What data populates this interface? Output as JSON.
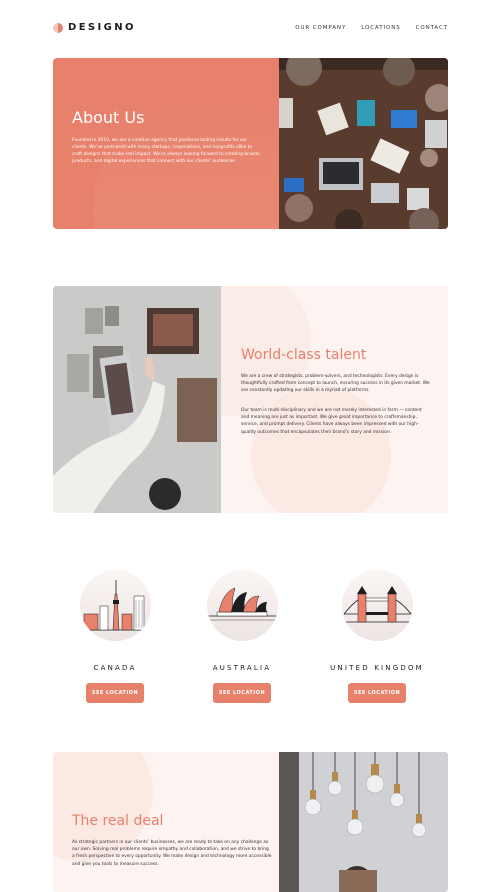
{
  "brand": {
    "name": "DESIGNO"
  },
  "nav": {
    "items": [
      "OUR COMPANY",
      "LOCATIONS",
      "CONTACT"
    ]
  },
  "about": {
    "title": "About Us",
    "body": "Founded in 2010, we are a creative agency that produces lasting results for our clients. We’ve partnered with many startups, corporations, and nonprofits alike to craft designs that make real impact. We’re always looking forward to creating brands, products, and digital experiences that connect with our clients’ audiences."
  },
  "talent": {
    "title": "World-class talent",
    "body1": "We are a crew of strategists, problem-solvers, and technologists. Every design is thoughtfully crafted from concept to launch, ensuring success in its given market. We are constantly updating our skills in a myriad of platforms.",
    "body2": "Our team is multi-disciplinary and we are not merely interested in form — content and meaning are just as important. We give great importance to craftsmanship, service, and prompt delivery. Clients have always been impressed with our high-quality outcomes that encapsulates their brand’s story and mission."
  },
  "locations": [
    {
      "name": "CANADA",
      "button": "SEE LOCATION",
      "icon": "toronto-skyline-icon"
    },
    {
      "name": "AUSTRALIA",
      "button": "SEE LOCATION",
      "icon": "sydney-opera-house-icon"
    },
    {
      "name": "UNITED KINGDOM",
      "button": "SEE LOCATION",
      "icon": "tower-bridge-icon"
    }
  ],
  "deal": {
    "title": "The real deal",
    "body": "As strategic partners in our clients’ businesses, we are ready to take on any challenge as our own. Solving real problems require empathy and collaboration, and we strive to bring a fresh perspective to every opportunity. We make design and technology more accessible and give you tools to measure success."
  },
  "colors": {
    "accent": "#e7816b",
    "peach": "#fdf3f0",
    "dark": "#333136"
  }
}
